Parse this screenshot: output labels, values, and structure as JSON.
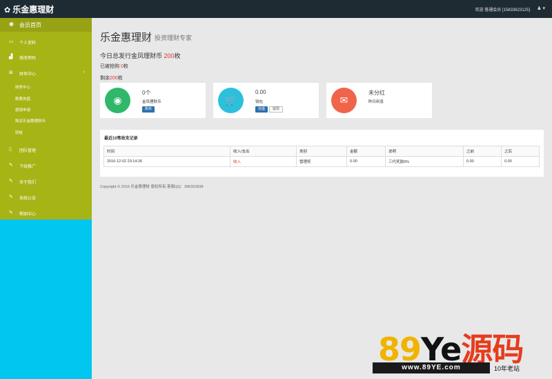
{
  "header": {
    "brand": "乐金惠理财",
    "brand_icon": "gear-icon",
    "welcome": "欢迎 普通会员 [15833623125]",
    "user_icon": "user-icon ▾"
  },
  "sidebar": {
    "home": "会员首页",
    "items": [
      {
        "label": "个人资料",
        "icon": "monitor-icon"
      },
      {
        "label": "修改密码",
        "icon": "chart-icon"
      },
      {
        "label": "财务中心",
        "icon": "sitemap-icon"
      },
      {
        "label": "团队管理",
        "icon": "tablet-icon"
      },
      {
        "label": "下线推广",
        "icon": "edit-icon"
      },
      {
        "label": "关于我们",
        "icon": "edit-icon"
      },
      {
        "label": "系统公告",
        "icon": "edit-icon"
      },
      {
        "label": "帮助中心",
        "icon": "edit-icon"
      }
    ],
    "sub_items": [
      "财务中心",
      "账票充值",
      "提现申请",
      "购买乐金惠理财币",
      "转帐"
    ]
  },
  "main": {
    "title": "乐金惠理财",
    "subtitle": "投资理财专家",
    "issued_prefix": "今日总发行金凤理财币",
    "issued_count": "200",
    "issued_unit": "枚",
    "sold_prefix": "已被抢购",
    "sold_count": "0",
    "sold_unit": "枚",
    "remaining_prefix": "剩余",
    "remaining_count": "200",
    "remaining_unit": "枚"
  },
  "boxes": [
    {
      "icon": "eye-icon",
      "color": "#2fb86a",
      "value": "0个",
      "label": "金凤理财币",
      "buttons": [
        "购买"
      ]
    },
    {
      "icon": "cart-icon",
      "color": "#2cc0dc",
      "value": "0.00",
      "label": "钱包",
      "buttons": [
        "充值",
        "提现"
      ]
    },
    {
      "icon": "chat-icon",
      "color": "#f0644a",
      "value": "未分红",
      "label": "昨日利息",
      "buttons": []
    }
  ],
  "records": {
    "title": "最近10笔收支记录",
    "columns": [
      "时间",
      "收入/支出",
      "类别",
      "金额",
      "说明",
      "之前",
      "之后"
    ],
    "rows": [
      [
        "2016-12-02 23:14:26",
        "收入",
        "管理奖",
        "0.00",
        "三代奖励0%",
        "0.00",
        "0.00"
      ]
    ]
  },
  "footer": {
    "copyright": "Copyright © 2016 乐金惠理财 版权所有 客服QQ：396322838"
  },
  "watermark": {
    "big_a": "89",
    "big_b": "Ye",
    "big_c": "源码",
    "url": "www.89YE.com",
    "tag": "10年老站"
  }
}
